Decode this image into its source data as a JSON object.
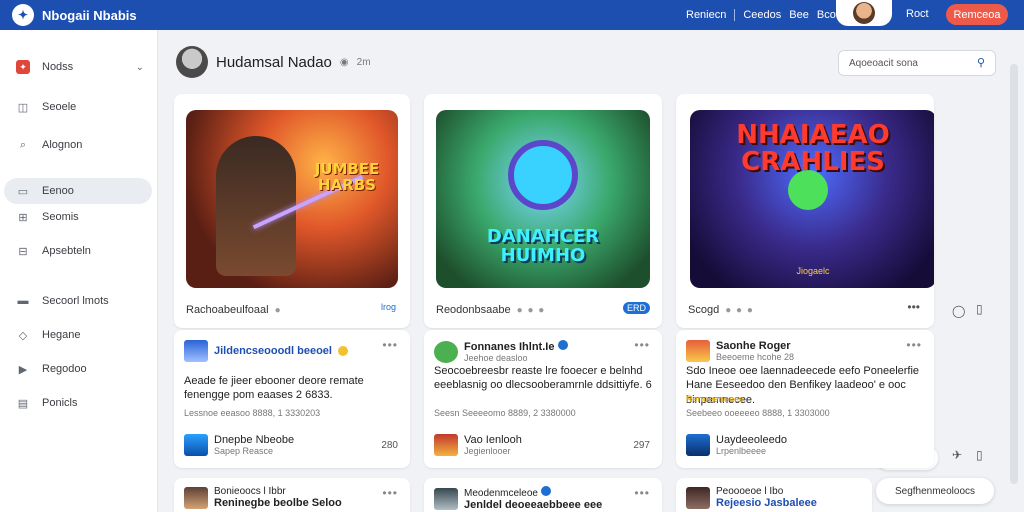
{
  "header": {
    "app_title": "Nbogaii Nbabis",
    "nav": [
      "Reniecn",
      "Ceedos",
      "Bee",
      "Bcons"
    ],
    "link": "Roct",
    "cta": "Remceoa"
  },
  "sidebar": {
    "items": [
      {
        "label": "Nodss",
        "icon": "app-logo-icon"
      },
      {
        "label": "Seoele",
        "icon": "camera-icon"
      },
      {
        "label": "Alognon",
        "icon": "search-icon"
      },
      {
        "label": "Eenoo",
        "icon": "image-icon"
      },
      {
        "label": "Seomis",
        "icon": "grid-icon"
      },
      {
        "label": "Apsebteln",
        "icon": "grid-icon"
      },
      {
        "label": "Secoorl lmots",
        "icon": "monitor-icon"
      },
      {
        "label": "Hegane",
        "icon": "tag-icon"
      },
      {
        "label": "Regodoo",
        "icon": "play-icon"
      },
      {
        "label": "Ponicls",
        "icon": "document-icon"
      }
    ]
  },
  "profile": {
    "name": "Hudamsal Nadao",
    "meta": "2m"
  },
  "search": {
    "placeholder": "Aqoeoacit sona"
  },
  "game_cards": [
    {
      "art_title": "JUMBEE\nHARBS",
      "name": "Rachoabeulfoaal",
      "tag": "lrog"
    },
    {
      "art_title": "DANAHCER\nHUIMHO",
      "name": "Reodonbsaabe",
      "tag": "ERD"
    },
    {
      "art_title": "NHAIAEAO\nCRAHLIES",
      "art_sub": "Jiogaelc",
      "name": "Scogd",
      "tag": ""
    }
  ],
  "posts": [
    {
      "author": "Jildencseooodl beeoel",
      "body": "Aeade fe jieer ebooner deore remate fenengge pom eaases 2 6833.",
      "sub": "Lessnoe eeasoo 8888, 1 3330203",
      "foot_title": "Dnepbe Nbeobe",
      "foot_meta": "Sapep Reasce",
      "count": "280"
    },
    {
      "author": "Fonnanes Ihlnt.Ie",
      "handle": "Jeehoe deasloo",
      "body": "Seocoebreesbr reaste lre fooecer e belnhd eeeblasnig oo dlecsooberamrnle ddsittiyfe. 6",
      "sub": "Seesn Seeeeomo 8889, 2 3380000",
      "foot_title": "Vao Ienlooh",
      "foot_meta": "Jegienlooer",
      "count": "297"
    },
    {
      "author": "Saonhe Roger",
      "handle": "Beeoeme hcohe 28",
      "body": "Sdo Ineoe oee laennadeecede eefo Poneelerfie Hane Eeseedoo den Benfikey laadeoo' e ooc binpamnecee.",
      "sub": "Renoeeneeee",
      "sub2": "Seebeeo ooeeeeo 8888, 1 3303000",
      "foot_title": "Uaydeeoleedo",
      "foot_meta": "Lrpenlbeeee",
      "count": ""
    }
  ],
  "bottom_posts": [
    {
      "author": "Bonieoocs l Ibbr",
      "line": "Reninegbe beolbe Seloo"
    },
    {
      "author": "Meodenmceleoe",
      "line": "Jenldel deoeeaebbeee eee"
    },
    {
      "author": "Peoooeoe l Ibo",
      "line": "Rejeesio Jasbaleee"
    }
  ],
  "floating_button": "Segfhenmeoloocs",
  "colors": {
    "brand": "#1d4fb1",
    "accent": "#ee5a4a",
    "verified": "#1d6fd1"
  }
}
